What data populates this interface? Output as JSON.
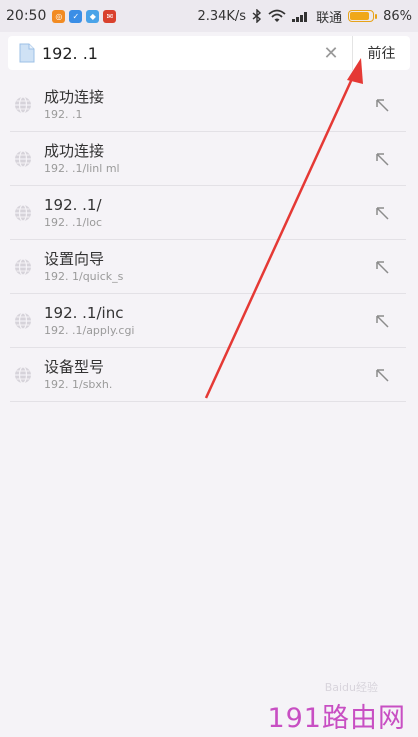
{
  "statusbar": {
    "time": "20:50",
    "speed": "2.34K/s",
    "carrier": "联通",
    "battery": "86%",
    "battery_level": 0.86,
    "notification_icons": [
      "weibo-icon",
      "shield-icon",
      "browser-icon",
      "mail-icon"
    ]
  },
  "addressbar": {
    "url": "192.          .1",
    "go_label": "前往",
    "icons": {
      "page": "document-icon",
      "clear": "close-icon"
    }
  },
  "suggestions": [
    {
      "title": "成功连接",
      "subtitle": "192.           .1"
    },
    {
      "title": "成功连接",
      "subtitle": "192.          .1/linl     ml"
    },
    {
      "title": "192.         .1/",
      "subtitle": "192.          .1/loc"
    },
    {
      "title": "设置向导",
      "subtitle": "192.          1/quick_s"
    },
    {
      "title": "192.           .1/inc",
      "subtitle": "192.          .1/apply.cgi"
    },
    {
      "title": "设备型号",
      "subtitle": "192.          1/sbxh."
    }
  ],
  "watermark": {
    "site": "191路由网",
    "logo": "Baidu经验"
  },
  "colors": {
    "annotation_arrow": "#e53935",
    "watermark": "#c84fc3",
    "battery": "#f0a81a"
  }
}
